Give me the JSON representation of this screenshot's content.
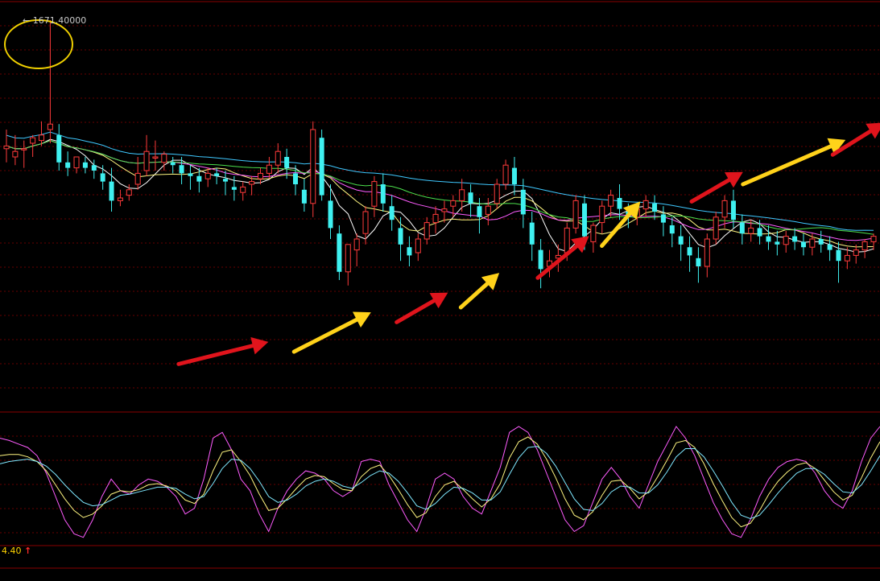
{
  "chart_data": [
    {
      "type": "candlestick",
      "panel": "price",
      "annotation": {
        "text": "1671.40000",
        "arrow": "←",
        "highlight": "circle"
      },
      "colors": {
        "up": "#ff3b3b",
        "down": "#3ff0f0",
        "ma_white": "#ffffff",
        "ma_yellow": "#fff680",
        "ma_magenta": "#ff5cff",
        "ma_green": "#4ce04c",
        "ma_blue": "#3fc8ff",
        "grid": "#8a0000",
        "up_arrow": "#e0141c",
        "down_arrow": "#ffd21a",
        "circle": "#f0d000"
      },
      "candles": [
        [
          0.53,
          0.6,
          0.54,
          0.48
        ],
        [
          0.5,
          0.58,
          0.52,
          0.47
        ],
        [
          0.53,
          0.56,
          0.53,
          0.46
        ],
        [
          0.55,
          0.58,
          0.57,
          0.5
        ],
        [
          0.56,
          0.63,
          0.58,
          0.54
        ],
        [
          0.6,
          1.0,
          0.62,
          0.55
        ],
        [
          0.58,
          0.62,
          0.48,
          0.45
        ],
        [
          0.48,
          0.52,
          0.46,
          0.43
        ],
        [
          0.46,
          0.5,
          0.5,
          0.44
        ],
        [
          0.48,
          0.5,
          0.46,
          0.44
        ],
        [
          0.47,
          0.49,
          0.45,
          0.42
        ],
        [
          0.44,
          0.47,
          0.41,
          0.38
        ],
        [
          0.41,
          0.46,
          0.34,
          0.3
        ],
        [
          0.34,
          0.38,
          0.35,
          0.32
        ],
        [
          0.36,
          0.4,
          0.38,
          0.34
        ],
        [
          0.4,
          0.5,
          0.44,
          0.38
        ],
        [
          0.45,
          0.58,
          0.52,
          0.43
        ],
        [
          0.5,
          0.56,
          0.5,
          0.45
        ],
        [
          0.48,
          0.52,
          0.51,
          0.45
        ],
        [
          0.48,
          0.5,
          0.47,
          0.44
        ],
        [
          0.47,
          0.5,
          0.44,
          0.4
        ],
        [
          0.44,
          0.47,
          0.43,
          0.38
        ],
        [
          0.43,
          0.46,
          0.41,
          0.37
        ],
        [
          0.42,
          0.46,
          0.44,
          0.39
        ],
        [
          0.44,
          0.46,
          0.43,
          0.4
        ],
        [
          0.42,
          0.45,
          0.41,
          0.36
        ],
        [
          0.39,
          0.43,
          0.38,
          0.34
        ],
        [
          0.37,
          0.41,
          0.39,
          0.34
        ],
        [
          0.4,
          0.43,
          0.41,
          0.36
        ],
        [
          0.42,
          0.46,
          0.44,
          0.4
        ],
        [
          0.44,
          0.5,
          0.47,
          0.42
        ],
        [
          0.47,
          0.55,
          0.52,
          0.44
        ],
        [
          0.5,
          0.53,
          0.46,
          0.42
        ],
        [
          0.44,
          0.47,
          0.4,
          0.36
        ],
        [
          0.38,
          0.42,
          0.33,
          0.3
        ],
        [
          0.33,
          0.63,
          0.6,
          0.28
        ],
        [
          0.57,
          0.6,
          0.36,
          0.34
        ],
        [
          0.34,
          0.4,
          0.24,
          0.2
        ],
        [
          0.22,
          0.25,
          0.08,
          0.05
        ],
        [
          0.08,
          0.14,
          0.18,
          0.03
        ],
        [
          0.16,
          0.22,
          0.2,
          0.1
        ],
        [
          0.22,
          0.32,
          0.3,
          0.18
        ],
        [
          0.32,
          0.43,
          0.41,
          0.28
        ],
        [
          0.4,
          0.44,
          0.33,
          0.3
        ],
        [
          0.32,
          0.36,
          0.27,
          0.23
        ],
        [
          0.24,
          0.28,
          0.18,
          0.12
        ],
        [
          0.17,
          0.21,
          0.14,
          0.1
        ],
        [
          0.15,
          0.22,
          0.2,
          0.12
        ],
        [
          0.2,
          0.28,
          0.26,
          0.18
        ],
        [
          0.26,
          0.32,
          0.29,
          0.22
        ],
        [
          0.3,
          0.34,
          0.31,
          0.26
        ],
        [
          0.32,
          0.36,
          0.34,
          0.28
        ],
        [
          0.34,
          0.42,
          0.38,
          0.3
        ],
        [
          0.37,
          0.4,
          0.33,
          0.28
        ],
        [
          0.32,
          0.35,
          0.28,
          0.22
        ],
        [
          0.29,
          0.35,
          0.32,
          0.25
        ],
        [
          0.33,
          0.42,
          0.4,
          0.31
        ],
        [
          0.4,
          0.49,
          0.47,
          0.38
        ],
        [
          0.46,
          0.5,
          0.4,
          0.36
        ],
        [
          0.38,
          0.42,
          0.29,
          0.24
        ],
        [
          0.26,
          0.3,
          0.18,
          0.12
        ],
        [
          0.16,
          0.2,
          0.09,
          0.02
        ],
        [
          0.1,
          0.16,
          0.12,
          0.06
        ],
        [
          0.13,
          0.18,
          0.14,
          0.08
        ],
        [
          0.15,
          0.26,
          0.24,
          0.12
        ],
        [
          0.24,
          0.36,
          0.34,
          0.22
        ],
        [
          0.33,
          0.36,
          0.21,
          0.16
        ],
        [
          0.19,
          0.26,
          0.25,
          0.15
        ],
        [
          0.26,
          0.34,
          0.32,
          0.22
        ],
        [
          0.32,
          0.38,
          0.36,
          0.28
        ],
        [
          0.35,
          0.4,
          0.31,
          0.27
        ],
        [
          0.3,
          0.33,
          0.28,
          0.24
        ],
        [
          0.28,
          0.33,
          0.31,
          0.25
        ],
        [
          0.31,
          0.36,
          0.34,
          0.28
        ],
        [
          0.33,
          0.36,
          0.3,
          0.27
        ],
        [
          0.29,
          0.32,
          0.26,
          0.21
        ],
        [
          0.25,
          0.28,
          0.22,
          0.17
        ],
        [
          0.21,
          0.25,
          0.18,
          0.12
        ],
        [
          0.17,
          0.21,
          0.14,
          0.08
        ],
        [
          0.13,
          0.17,
          0.1,
          0.04
        ],
        [
          0.1,
          0.22,
          0.2,
          0.06
        ],
        [
          0.2,
          0.3,
          0.28,
          0.18
        ],
        [
          0.28,
          0.36,
          0.34,
          0.24
        ],
        [
          0.34,
          0.38,
          0.27,
          0.24
        ],
        [
          0.26,
          0.29,
          0.22,
          0.18
        ],
        [
          0.22,
          0.27,
          0.24,
          0.19
        ],
        [
          0.24,
          0.27,
          0.21,
          0.18
        ],
        [
          0.21,
          0.25,
          0.19,
          0.16
        ],
        [
          0.19,
          0.23,
          0.18,
          0.14
        ],
        [
          0.18,
          0.23,
          0.21,
          0.15
        ],
        [
          0.21,
          0.24,
          0.19,
          0.16
        ],
        [
          0.19,
          0.22,
          0.17,
          0.14
        ],
        [
          0.17,
          0.22,
          0.2,
          0.14
        ],
        [
          0.2,
          0.23,
          0.18,
          0.15
        ],
        [
          0.18,
          0.21,
          0.16,
          0.12
        ],
        [
          0.16,
          0.19,
          0.12,
          0.04
        ],
        [
          0.12,
          0.17,
          0.14,
          0.09
        ],
        [
          0.14,
          0.18,
          0.16,
          0.11
        ],
        [
          0.16,
          0.2,
          0.19,
          0.13
        ],
        [
          0.19,
          0.22,
          0.21,
          0.16
        ]
      ],
      "ma_series": [
        {
          "name": "MA5",
          "color": "#ffffff",
          "period": 5
        },
        {
          "name": "MA10",
          "color": "#fff680",
          "period": 10
        },
        {
          "name": "MA20",
          "color": "#ff5cff",
          "period": 20
        },
        {
          "name": "MA30",
          "color": "#4ce04c",
          "period": 30
        },
        {
          "name": "MA60",
          "color": "#3fc8ff",
          "period": 60
        }
      ],
      "markup_arrows": [
        {
          "dir": "up",
          "from": [
            0.02,
            0.27
          ],
          "to": [
            0.09,
            0.36
          ]
        },
        {
          "dir": "down",
          "from": [
            0.11,
            0.32
          ],
          "to": [
            0.17,
            0.48
          ]
        },
        {
          "dir": "up",
          "from": [
            0.19,
            0.44
          ],
          "to": [
            0.23,
            0.56
          ]
        },
        {
          "dir": "down",
          "from": [
            0.24,
            0.5
          ],
          "to": [
            0.27,
            0.64
          ]
        },
        {
          "dir": "up",
          "from": [
            0.3,
            0.62
          ],
          "to": [
            0.34,
            0.79
          ]
        },
        {
          "dir": "down",
          "from": [
            0.35,
            0.75
          ],
          "to": [
            0.38,
            0.93
          ]
        },
        {
          "dir": "up",
          "from": [
            0.42,
            0.93
          ],
          "to": [
            0.46,
            1.05
          ]
        },
        {
          "dir": "down",
          "from": [
            0.46,
            1.0
          ],
          "to": [
            0.54,
            1.18
          ]
        },
        {
          "dir": "up",
          "from": [
            0.53,
            1.12
          ],
          "to": [
            0.57,
            1.25
          ]
        },
        {
          "dir": "down",
          "from": [
            0.57,
            1.27
          ],
          "to": [
            0.68,
            1.5
          ]
        }
      ]
    },
    {
      "type": "line",
      "panel": "oscillator",
      "label": "4.40",
      "label_arrow": "↑",
      "series": [
        {
          "color": "#ff5cff",
          "values": [
            0.9,
            0.88,
            0.85,
            0.82,
            0.75,
            0.6,
            0.4,
            0.2,
            0.08,
            0.05,
            0.2,
            0.4,
            0.55,
            0.45,
            0.42,
            0.5,
            0.55,
            0.53,
            0.48,
            0.4,
            0.25,
            0.3,
            0.55,
            0.9,
            0.95,
            0.8,
            0.55,
            0.45,
            0.25,
            0.1,
            0.3,
            0.45,
            0.55,
            0.62,
            0.6,
            0.55,
            0.45,
            0.4,
            0.45,
            0.7,
            0.72,
            0.7,
            0.5,
            0.35,
            0.2,
            0.1,
            0.3,
            0.55,
            0.6,
            0.55,
            0.4,
            0.3,
            0.25,
            0.45,
            0.65,
            0.95,
            1.0,
            0.95,
            0.8,
            0.6,
            0.4,
            0.2,
            0.1,
            0.15,
            0.35,
            0.55,
            0.65,
            0.55,
            0.4,
            0.3,
            0.5,
            0.7,
            0.85,
            1.0,
            0.9,
            0.75,
            0.55,
            0.35,
            0.2,
            0.08,
            0.05,
            0.2,
            0.4,
            0.55,
            0.65,
            0.7,
            0.72,
            0.7,
            0.6,
            0.45,
            0.35,
            0.3,
            0.45,
            0.7,
            0.9,
            1.0
          ]
        },
        {
          "color": "#fff680",
          "values": [
            0.75,
            0.76,
            0.76,
            0.74,
            0.7,
            0.62,
            0.5,
            0.38,
            0.28,
            0.22,
            0.25,
            0.32,
            0.42,
            0.45,
            0.44,
            0.46,
            0.5,
            0.51,
            0.49,
            0.45,
            0.37,
            0.34,
            0.42,
            0.62,
            0.78,
            0.8,
            0.7,
            0.58,
            0.42,
            0.28,
            0.3,
            0.38,
            0.47,
            0.55,
            0.58,
            0.57,
            0.51,
            0.46,
            0.45,
            0.57,
            0.64,
            0.67,
            0.58,
            0.46,
            0.33,
            0.22,
            0.26,
            0.4,
            0.5,
            0.53,
            0.46,
            0.38,
            0.31,
            0.38,
            0.51,
            0.73,
            0.87,
            0.91,
            0.85,
            0.72,
            0.56,
            0.38,
            0.24,
            0.2,
            0.27,
            0.41,
            0.53,
            0.54,
            0.47,
            0.38,
            0.44,
            0.57,
            0.71,
            0.86,
            0.88,
            0.82,
            0.68,
            0.51,
            0.36,
            0.22,
            0.14,
            0.17,
            0.28,
            0.42,
            0.53,
            0.61,
            0.67,
            0.69,
            0.64,
            0.54,
            0.44,
            0.37,
            0.41,
            0.56,
            0.73,
            0.87
          ]
        },
        {
          "color": "#7fe8ff",
          "values": [
            0.68,
            0.7,
            0.71,
            0.72,
            0.7,
            0.66,
            0.59,
            0.5,
            0.42,
            0.35,
            0.32,
            0.33,
            0.37,
            0.41,
            0.42,
            0.44,
            0.46,
            0.48,
            0.48,
            0.47,
            0.42,
            0.38,
            0.4,
            0.51,
            0.64,
            0.72,
            0.71,
            0.64,
            0.53,
            0.4,
            0.35,
            0.37,
            0.42,
            0.49,
            0.53,
            0.55,
            0.53,
            0.49,
            0.47,
            0.52,
            0.58,
            0.62,
            0.6,
            0.53,
            0.43,
            0.32,
            0.29,
            0.34,
            0.42,
            0.48,
            0.47,
            0.43,
            0.37,
            0.37,
            0.44,
            0.59,
            0.73,
            0.82,
            0.83,
            0.77,
            0.66,
            0.52,
            0.38,
            0.29,
            0.28,
            0.34,
            0.44,
            0.49,
            0.48,
            0.43,
            0.43,
            0.5,
            0.61,
            0.74,
            0.81,
            0.81,
            0.74,
            0.62,
            0.49,
            0.35,
            0.24,
            0.21,
            0.24,
            0.33,
            0.43,
            0.52,
            0.6,
            0.64,
            0.64,
            0.59,
            0.51,
            0.44,
            0.43,
            0.5,
            0.62,
            0.75
          ]
        }
      ]
    }
  ]
}
